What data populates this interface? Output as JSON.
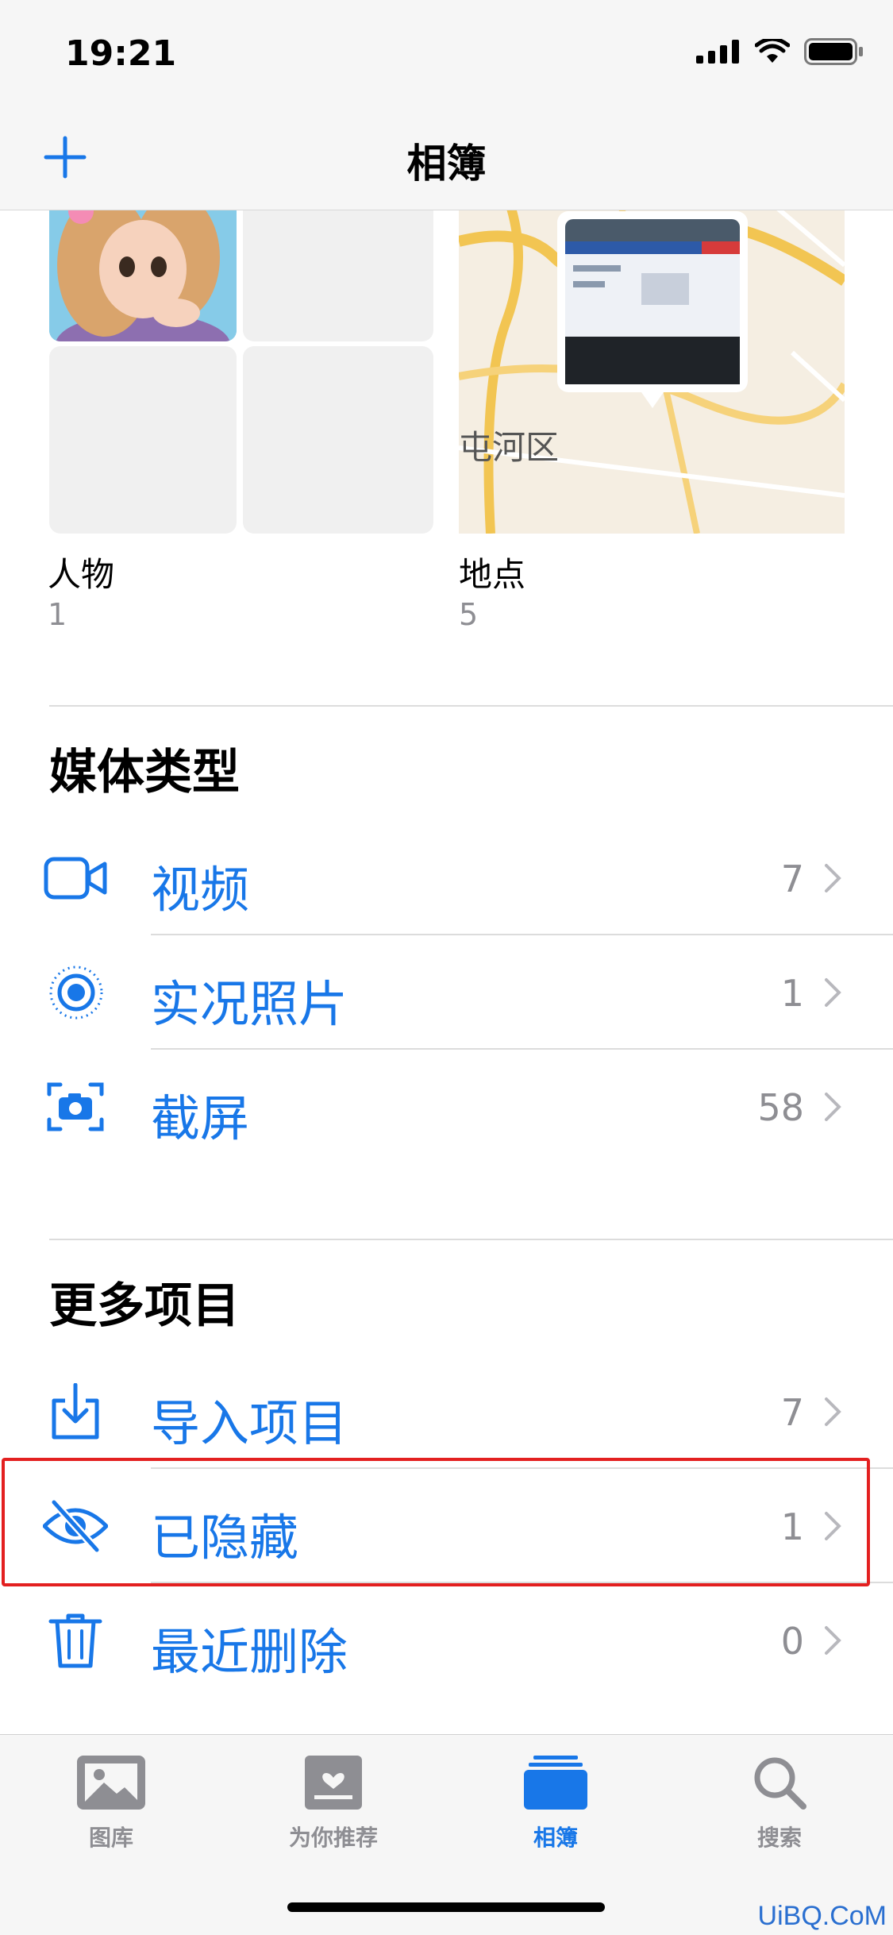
{
  "status_bar": {
    "time": "19:21"
  },
  "nav": {
    "title": "相簿"
  },
  "albums": [
    {
      "label": "人物",
      "count": "1"
    },
    {
      "label": "地点",
      "count": "5",
      "map_text": "屯河区"
    }
  ],
  "media_types": {
    "title": "媒体类型",
    "items": [
      {
        "label": "视频",
        "count": "7",
        "icon": "video-icon"
      },
      {
        "label": "实况照片",
        "count": "1",
        "icon": "live-photo-icon"
      },
      {
        "label": "截屏",
        "count": "58",
        "icon": "screenshot-icon"
      }
    ]
  },
  "more_items": {
    "title": "更多项目",
    "items": [
      {
        "label": "导入项目",
        "count": "7",
        "icon": "import-icon"
      },
      {
        "label": "已隐藏",
        "count": "1",
        "icon": "eye-slash-icon"
      },
      {
        "label": "最近删除",
        "count": "0",
        "icon": "trash-icon"
      }
    ]
  },
  "tabbar": {
    "tabs": [
      {
        "label": "图库",
        "icon": "photos-icon",
        "active": false
      },
      {
        "label": "为你推荐",
        "icon": "for-you-icon",
        "active": false
      },
      {
        "label": "相簿",
        "icon": "albums-icon",
        "active": true
      },
      {
        "label": "搜索",
        "icon": "search-icon",
        "active": false
      }
    ]
  },
  "colors": {
    "accent": "#1877e8",
    "secondary": "#8e8e93",
    "highlight": "#e32020"
  },
  "watermark": "UiBQ.CoM"
}
